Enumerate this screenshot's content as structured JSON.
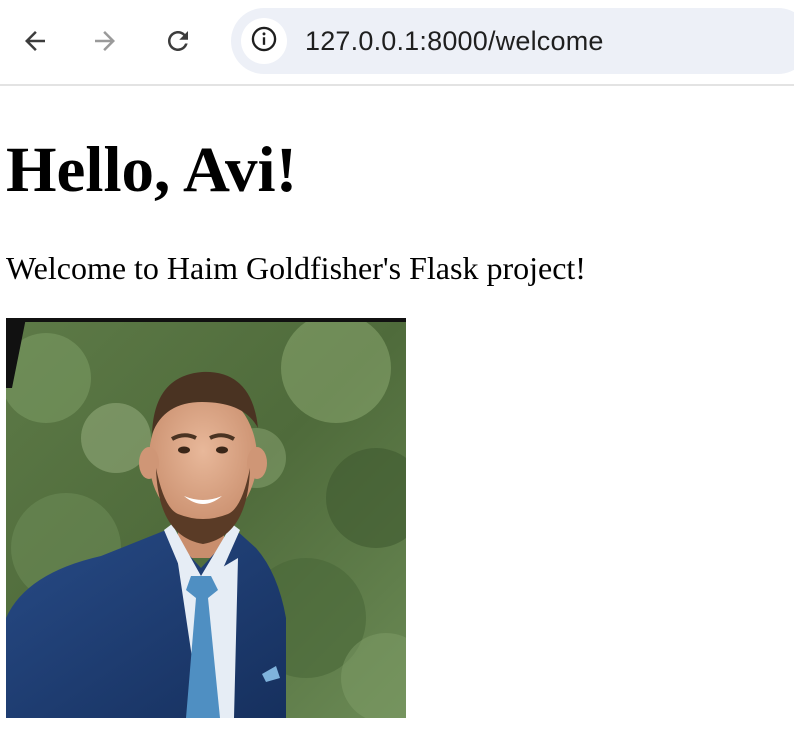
{
  "browser": {
    "url": "127.0.0.1:8000/welcome",
    "icons": {
      "back": "arrow-left-icon",
      "forward": "arrow-right-icon",
      "reload": "reload-icon",
      "site_info": "info-icon"
    }
  },
  "page": {
    "heading": "Hello, Avi!",
    "welcome_text": "Welcome to Haim Goldfisher's Flask project!",
    "photo": {
      "subject": "smiling bearded man in navy suit and light blue tie against green foliage"
    }
  },
  "colors": {
    "omnibox_bg": "#edf0f7",
    "toolbar_border": "#e3e3e3",
    "text": "#000000"
  }
}
